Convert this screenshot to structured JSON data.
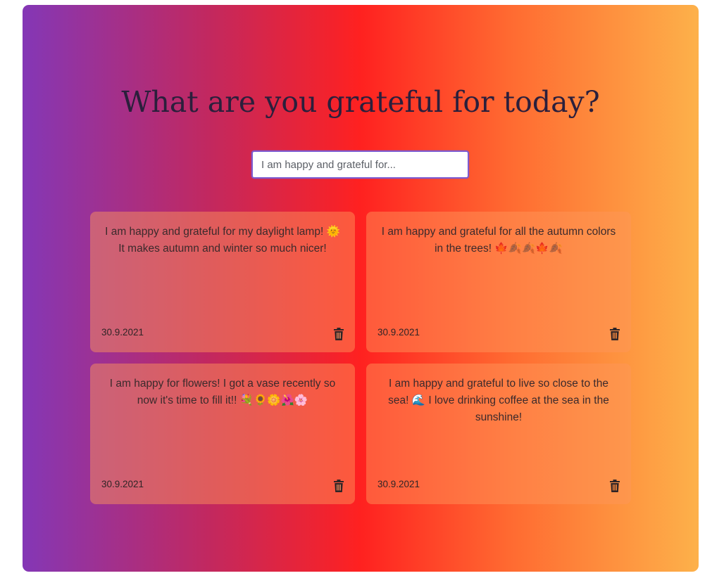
{
  "page": {
    "title": "What are you grateful for today?"
  },
  "input": {
    "placeholder": "I am happy and grateful for...",
    "value": ""
  },
  "entries": [
    {
      "text": "I am happy and grateful for my daylight lamp! 🌞 It makes autumn and winter so much nicer!",
      "date": "30.9.2021"
    },
    {
      "text": "I am happy and grateful for all the autumn colors in the trees! 🍁🍂🍂🍁🍂",
      "date": "30.9.2021"
    },
    {
      "text": "I am happy for flowers! I got a vase recently so now it's time to fill it!! 💐🌻🌼🌺🌸",
      "date": "30.9.2021"
    },
    {
      "text": "I am happy and grateful to live so close to the sea! 🌊 I love drinking coffee at the sea in the sunshine!",
      "date": "30.9.2021"
    }
  ],
  "icons": {
    "delete": "trash-icon"
  },
  "colors": {
    "gradient": [
      "#8437b6",
      "#c3285e",
      "#ff2120",
      "#ff6a31",
      "#fdb14a"
    ],
    "title": "#2b1f3c",
    "input_border": "#7d5bd0"
  }
}
